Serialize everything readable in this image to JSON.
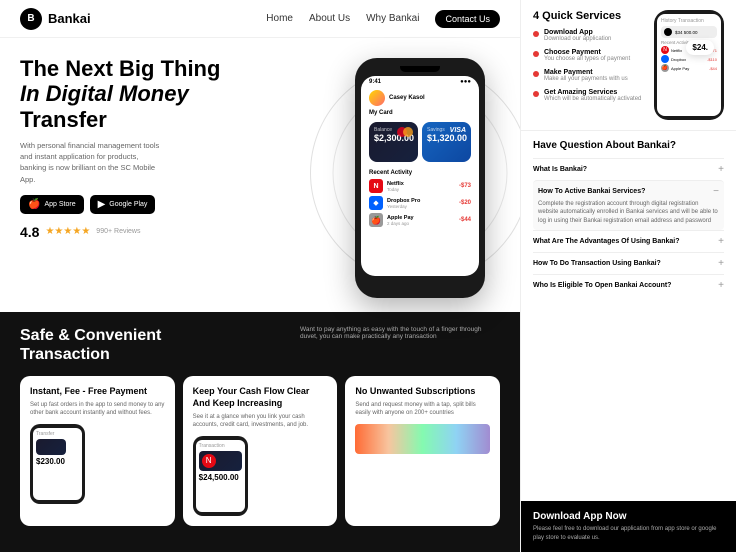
{
  "nav": {
    "logo_letter": "B",
    "brand": "Bankai",
    "links": [
      "Home",
      "About Us",
      "Why Bankai"
    ],
    "cta": "Contact Us"
  },
  "hero": {
    "title_line1": "The Next Big Thing",
    "title_line2": "In Digital Money",
    "title_line3": "Transfer",
    "description": "With personal financial management tools and instant application for products, banking is now brilliant on the SC Mobile App.",
    "app_store_label": "App Store",
    "play_store_label": "Google Play",
    "rating": "4.8",
    "rating_count": "990+ Reviews"
  },
  "phone": {
    "time": "9:41",
    "user": "Casey Kasol",
    "my_card_label": "My Card",
    "card1_amount": "$2,300.00",
    "card2_amount": "$1,320.00",
    "recent_activity": "Recent Activity",
    "transactions": [
      {
        "name": "Netflix",
        "date": "Today",
        "amount": "-$73",
        "type": "neg"
      },
      {
        "name": "Dropbox Pro",
        "date": "Yesterday",
        "amount": "-$20",
        "type": "neg"
      },
      {
        "name": "Apple Pay",
        "date": "2 days ago",
        "amount": "-$44",
        "type": "neg"
      }
    ]
  },
  "dark_section": {
    "title_line1": "Safe & Convenient",
    "title_line2": "Transaction",
    "description": "Want to pay anything as easy with the touch of a finger through duvet, you can make practically any transaction",
    "feature1_title": "Instant, Fee - Free Payment",
    "feature1_desc": "Set up fast orders in the app to send money to any other bank account instantly and without fees.",
    "feature1_amount": "$230.00",
    "feature2_title": "Keep Your Cash Flow Clear And Keep Increasing",
    "feature2_desc": "See it at a glance when you link your cash accounts, credit card, investments, and job.",
    "feature2_amount": "$24,500.00",
    "feature3_title": "No Unwanted Subscriptions",
    "feature3_desc": "Send and request money with a tap, split bills easily with anyone on 200+ countries"
  },
  "sidebar": {
    "quick_services_title": "4 Quick Services",
    "services": [
      {
        "label": "Download App",
        "desc": "Download our application"
      },
      {
        "label": "Choose Payment",
        "desc": "You choose all types of payment"
      },
      {
        "label": "Make Payment",
        "desc": "Make all your payments with us"
      },
      {
        "label": "Get Amazing Services",
        "desc": "Which will be automatically activated"
      }
    ],
    "amount_badge": "$24.",
    "faq_title": "Have Question About Bankai?",
    "faqs": [
      {
        "q": "What Is Bankai?",
        "expanded": false,
        "answer": ""
      },
      {
        "q": "How To Active Bankai Services?",
        "expanded": true,
        "answer": "Complete the registration account through digital registration website automatically enrolled in Bankai services and will be able to log in using their Bankai registration email address and password"
      },
      {
        "q": "What Are The Advantages Of Using Bankai?",
        "expanded": false,
        "answer": ""
      },
      {
        "q": "How To Do Transaction Using Bankai?",
        "expanded": false,
        "answer": ""
      },
      {
        "q": "Who Is Eligible To Open Bankai Account?",
        "expanded": false,
        "answer": ""
      }
    ],
    "download_title": "Download App Now",
    "download_desc": "Please feel free to download our application from app store or google play store to evaluate us."
  }
}
